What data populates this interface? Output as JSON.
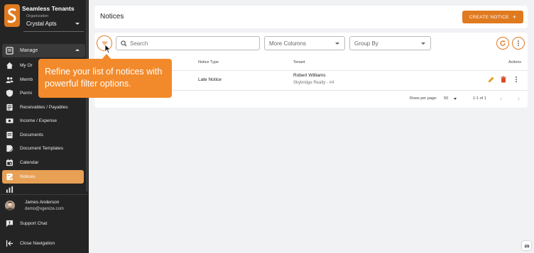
{
  "sidebar": {
    "brand_title": "Seamless Tenants",
    "org_label": "Organization",
    "org_value": "Crystal Apts",
    "manage_label": "Manage",
    "items": [
      {
        "label": "My Or",
        "icon": "house-icon"
      },
      {
        "label": "Memb",
        "icon": "people-icon"
      },
      {
        "label": "Permi",
        "icon": "shield-icon"
      },
      {
        "label": "Receivables / Payables",
        "icon": "receipt-icon"
      },
      {
        "label": "Income / Expense",
        "icon": "money-icon"
      },
      {
        "label": "Documents",
        "icon": "document-icon"
      },
      {
        "label": "Document Templates",
        "icon": "template-icon"
      },
      {
        "label": "Calendar",
        "icon": "calendar-icon"
      },
      {
        "label": "Notices",
        "icon": "notice-icon"
      },
      {
        "label": "",
        "icon": "chart-icon"
      }
    ],
    "user": {
      "name": "James Anderson",
      "email": "demo@xgenize.com"
    },
    "support_label": "Support Chat",
    "close_label": "Close Navigation"
  },
  "header": {
    "title": "Notices",
    "create_label": "CREATE NOTICE",
    "create_icon": "plus-icon"
  },
  "toolbar": {
    "search_placeholder": "Search",
    "more_columns": "More Columns",
    "group_by": "Group By"
  },
  "table": {
    "columns": [
      "Notice Type",
      "Tenant",
      "Actions"
    ],
    "rows": [
      {
        "notice_type": "Late Notice",
        "tenant_name": "Robert Williams",
        "tenant_detail": "Skybridge Realty - #4"
      }
    ],
    "rows_per_page_label": "Rows per page:",
    "rows_per_page": "50",
    "range": "1-1 of 1"
  },
  "tooltip": {
    "text": "Refine your list of notices with powerful filter options."
  },
  "colors": {
    "accent": "#e07a1f",
    "tooltip": "#f28a2b",
    "active_nav": "#e8a055",
    "sidebar": "#242424"
  }
}
